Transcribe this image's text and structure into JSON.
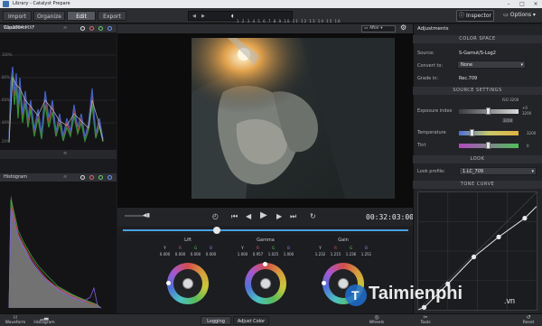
{
  "window": {
    "title": "Library - Catalyst Prepare"
  },
  "toolbar": {
    "tabs": [
      "Import",
      "Organize",
      "Edit",
      "Export"
    ],
    "active_tab": "Edit",
    "audio_tracks": "1 2 3 4 5 6 7 8 9 10 11 12 13 14 15 16",
    "inspector_label": "Inspector",
    "options_label": "Options"
  },
  "left": {
    "waveform_title": "Waveform",
    "histogram_title": "Histogram",
    "clip_name": "Clip0094.MXF",
    "scope_ticks": [
      "100%",
      "80%",
      "60%",
      "40%",
      "20%"
    ]
  },
  "viewer": {
    "compare_mode": "After"
  },
  "player": {
    "timecode": "00:32:03:00"
  },
  "wheels": [
    {
      "name": "Lift",
      "channels": [
        "Y",
        "R",
        "G",
        "B"
      ],
      "values": [
        "0.000",
        "0.000",
        "0.000",
        "0.000"
      ]
    },
    {
      "name": "Gamma",
      "channels": [
        "Y",
        "R",
        "G",
        "B"
      ],
      "values": [
        "1.000",
        "0.957",
        "1.025",
        "1.000"
      ]
    },
    {
      "name": "Gain",
      "channels": [
        "Y",
        "R",
        "G",
        "B"
      ],
      "values": [
        "1.232",
        "1.215",
        "1.236",
        "1.251"
      ]
    }
  ],
  "bottom": {
    "waveform": "Waveform",
    "histogram": "Histogram",
    "logging": "Logging",
    "adjust_color": "Adjust Color",
    "wheels": "Wheels",
    "tools": "Tools",
    "reset": "Reset"
  },
  "adjustments": {
    "title": "Adjustments",
    "color_space_head": "COLOR SPACE",
    "source_label": "Source:",
    "source_value": "S-Gamut/S-Log2",
    "convert_label": "Convert to:",
    "convert_value": "None",
    "grade_label": "Grade in:",
    "grade_value": "Rec.709",
    "source_settings_head": "SOURCE SETTINGS",
    "iso": "ISO 3200",
    "exposure_label": "Exposure index",
    "exposure_vals": [
      "+0",
      "3200"
    ],
    "iso_small": "3200",
    "temperature_label": "Temperature",
    "temperature_val": "3200",
    "tint_label": "Tint",
    "tint_val": "0",
    "look_head": "LOOK",
    "look_profile_label": "Look profile:",
    "look_profile_value": "1.LC_709",
    "tone_curve_head": "TONE CURVE",
    "tone_curve_points": [
      [
        0.05,
        0.02
      ],
      [
        0.25,
        0.22
      ],
      [
        0.47,
        0.45
      ],
      [
        0.68,
        0.62
      ],
      [
        0.9,
        0.78
      ]
    ]
  },
  "watermark": {
    "text": "Taimienphi",
    "domain": ".vn"
  },
  "colors": {
    "accent": "#4aa0e0",
    "panel": "#232428",
    "viewer_bg": "#0c0c0d"
  }
}
